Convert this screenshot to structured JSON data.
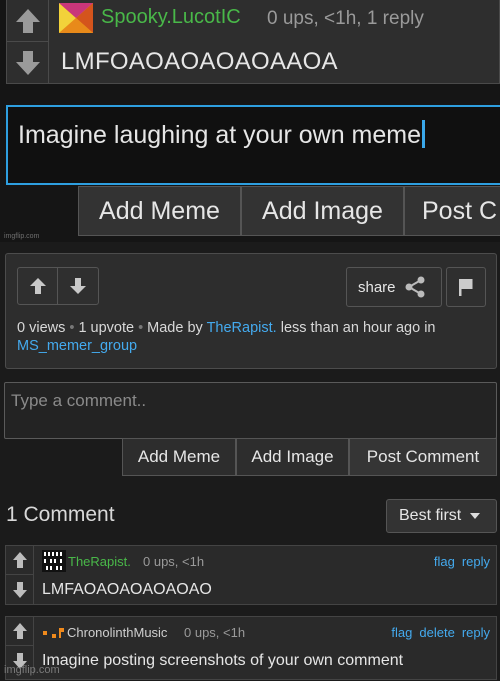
{
  "screenshot": {
    "comment": {
      "username": "Spooky.LucotIC",
      "meta": "0 ups, <1h, 1 reply",
      "text": "LMFOAOAOAOAOAAOA"
    },
    "reply_input_value": "Imagine laughing at your own meme",
    "buttons": {
      "add_meme": "Add Meme",
      "add_image": "Add Image",
      "post_comment_truncated": "Post C"
    },
    "watermark": "imgflip.com"
  },
  "meme_footer": {
    "share_label": "share",
    "stats": {
      "views": "0 views",
      "upvotes": "1 upvote",
      "made_by_prefix": "Made by",
      "author": "TheRapist.",
      "time": "less than an hour ago in",
      "stream": "MS_memer_group"
    }
  },
  "comment_box": {
    "placeholder": "Type a comment..",
    "add_meme": "Add Meme",
    "add_image": "Add Image",
    "post_comment": "Post Comment"
  },
  "comments": {
    "count_label": "1 Comment",
    "sort_label": "Best first",
    "items": [
      {
        "username": "TheRapist.",
        "meta": "0 ups, <1h",
        "text": "LMFAOAOAOAOAOAO",
        "actions": [
          "flag",
          "reply"
        ]
      },
      {
        "username": "ChronolinthMusic",
        "meta": "0 ups, <1h",
        "text": "Imagine posting screenshots of your own comment",
        "actions": [
          "flag",
          "delete",
          "reply"
        ]
      }
    ]
  },
  "watermark": "imgflip.com",
  "colors": {
    "link": "#44aaee",
    "green_username": "#49b849",
    "input_focus_border": "#2e9fe0",
    "background": "#1b1b1b"
  },
  "icons": [
    "upvote-arrow-icon",
    "downvote-arrow-icon",
    "share-icon",
    "flag-icon",
    "caret-down-icon",
    "avatar-icon"
  ]
}
